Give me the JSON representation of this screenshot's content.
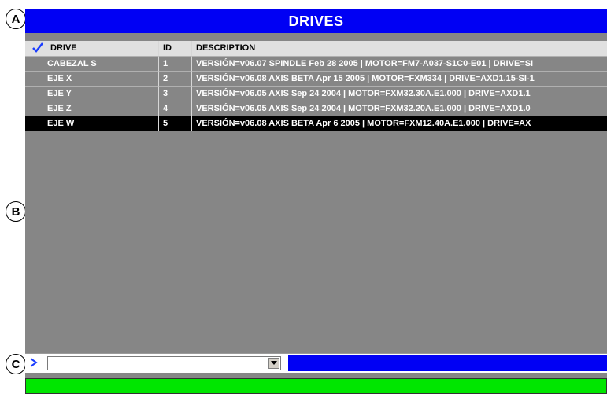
{
  "callouts": {
    "a": "A",
    "b": "B",
    "c": "C"
  },
  "title": "DRIVES",
  "columns": {
    "drive": "DRIVE",
    "id": "ID",
    "description": "DESCRIPTION"
  },
  "rows": [
    {
      "drive": "CABEZAL S",
      "id": "1",
      "description": "VERSIÓN=v06.07 SPINDLE Feb 28 2005  |  MOTOR=FM7-A037-S1C0-E01  |  DRIVE=SI"
    },
    {
      "drive": "EJE X",
      "id": "2",
      "description": "VERSIÓN=v06.08 AXIS BETA Apr 15 2005  |  MOTOR=FXM334  |  DRIVE=AXD1.15-SI-1"
    },
    {
      "drive": "EJE Y",
      "id": "3",
      "description": "VERSIÓN=v06.05 AXIS Sep 24 2004  |  MOTOR=FXM32.30A.E1.000  |  DRIVE=AXD1.1"
    },
    {
      "drive": "EJE Z",
      "id": "4",
      "description": "VERSIÓN=v06.05 AXIS Sep 24 2004  |  MOTOR=FXM32.20A.E1.000  |  DRIVE=AXD1.0"
    },
    {
      "drive": "EJE W",
      "id": "5",
      "description": "VERSIÓN=v06.08 AXIS BETA Apr  6 2005  |  MOTOR=FXM12.40A.E1.000  |  DRIVE=AX"
    }
  ],
  "selected_row": 4,
  "command_input": {
    "value": ""
  },
  "icons": {
    "check": "checkmark-icon",
    "combo": "chevron-down-icon",
    "marker": "triangle-right-icon"
  },
  "colors": {
    "title_bg": "#0000f4",
    "grid_bg": "#868686",
    "status_blue": "#0000f4",
    "status_green": "#00e600",
    "check": "#1a3cff"
  }
}
